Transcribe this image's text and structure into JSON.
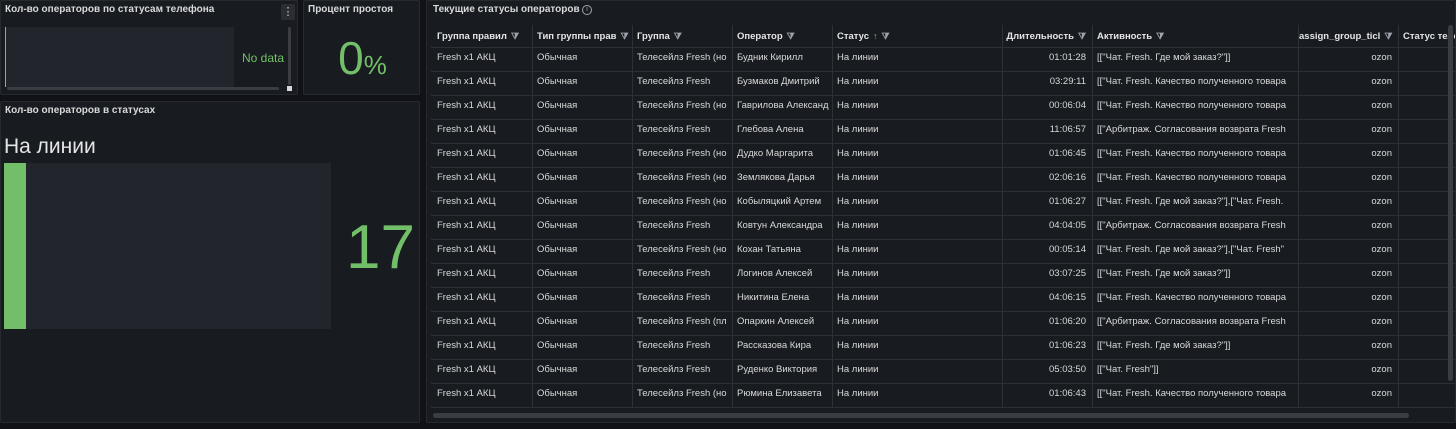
{
  "panels": {
    "phone_status": {
      "title": "Кол-во операторов по статусам телефона",
      "menu_icon": "kebab-icon",
      "no_data": "No data"
    },
    "idle_percent": {
      "title": "Процент простоя",
      "value": "0",
      "unit": "%"
    },
    "status_count": {
      "title": "Кол-во операторов в статусах",
      "status_label": "На линии",
      "value": "17",
      "color": "#73bf69"
    },
    "current_statuses": {
      "title": "Текущие статусы операторов",
      "info_icon": "info-circle-icon"
    }
  },
  "table": {
    "headers": [
      "Группа правил",
      "Тип группы прав",
      "Группа",
      "Оператор",
      "Статус",
      "Длительность",
      "Активность",
      "assign_group_ticl",
      "Статус теле"
    ],
    "sort_icon": "sort-ascending-icon",
    "filter_icon": "filter-icon",
    "rows": [
      [
        "Fresh x1 АКЦ",
        "Обычная",
        "Телесейлз Fresh (но",
        "Будник Кирилл",
        "На линии",
        "01:01:28",
        "[[\"Чат. Fresh. Где мой заказ?\"]]",
        "ozon"
      ],
      [
        "Fresh x1 АКЦ",
        "Обычная",
        "Телесейлз Fresh",
        "Бузмаков Дмитрий",
        "На линии",
        "03:29:11",
        "[[\"Чат. Fresh. Качество полученного товара",
        "ozon"
      ],
      [
        "Fresh x1 АКЦ",
        "Обычная",
        "Телесейлз Fresh (но",
        "Гаврилова Александ",
        "На линии",
        "00:06:04",
        "[[\"Чат. Fresh. Качество полученного товара",
        "ozon"
      ],
      [
        "Fresh x1 АКЦ",
        "Обычная",
        "Телесейлз Fresh",
        "Глебова Алена",
        "На линии",
        "11:06:57",
        "[[\"Арбитраж. Согласования возврата Fresh",
        "ozon"
      ],
      [
        "Fresh x1 АКЦ",
        "Обычная",
        "Телесейлз Fresh (но",
        "Дудко Маргарита",
        "На линии",
        "01:06:45",
        "[[\"Чат. Fresh. Качество полученного товара",
        "ozon"
      ],
      [
        "Fresh x1 АКЦ",
        "Обычная",
        "Телесейлз Fresh (но",
        "Землякова Дарья",
        "На линии",
        "02:06:16",
        "[[\"Чат. Fresh. Качество полученного товара",
        "ozon"
      ],
      [
        "Fresh x1 АКЦ",
        "Обычная",
        "Телесейлз Fresh (но",
        "Кобыляцкий Артем",
        "На линии",
        "01:06:27",
        "[[\"Чат. Fresh. Где мой заказ?\"],[\"Чат. Fresh.",
        "ozon"
      ],
      [
        "Fresh x1 АКЦ",
        "Обычная",
        "Телесейлз Fresh",
        "Ковтун Александра",
        "На линии",
        "04:04:05",
        "[[\"Арбитраж. Согласования возврата Fresh",
        "ozon"
      ],
      [
        "Fresh x1 АКЦ",
        "Обычная",
        "Телесейлз Fresh (но",
        "Кохан Татьяна",
        "На линии",
        "00:05:14",
        "[[\"Чат. Fresh. Где мой заказ?\"],[\"Чат. Fresh\"",
        "ozon"
      ],
      [
        "Fresh x1 АКЦ",
        "Обычная",
        "Телесейлз Fresh",
        "Логинов Алексей",
        "На линии",
        "03:07:25",
        "[[\"Чат. Fresh. Где мой заказ?\"]]",
        "ozon"
      ],
      [
        "Fresh x1 АКЦ",
        "Обычная",
        "Телесейлз Fresh",
        "Никитина Елена",
        "На линии",
        "04:06:15",
        "[[\"Чат. Fresh. Качество полученного товара",
        "ozon"
      ],
      [
        "Fresh x1 АКЦ",
        "Обычная",
        "Телесейлз Fresh (пл",
        "Опаркин Алексей",
        "На линии",
        "01:06:20",
        "[[\"Арбитраж. Согласования возврата Fresh",
        "ozon"
      ],
      [
        "Fresh x1 АКЦ",
        "Обычная",
        "Телесейлз Fresh",
        "Рассказова Кира",
        "На линии",
        "01:06:23",
        "[[\"Чат. Fresh. Где мой заказ?\"]]",
        "ozon"
      ],
      [
        "Fresh x1 АКЦ",
        "Обычная",
        "Телесейлз Fresh",
        "Руденко Виктория",
        "На линии",
        "05:03:50",
        "[[\"Чат. Fresh\"]]",
        "ozon"
      ],
      [
        "Fresh x1 АКЦ",
        "Обычная",
        "Телесейлз Fresh (но",
        "Рюмина Елизавета",
        "На линии",
        "01:06:43",
        "[[\"Чат. Fresh. Качество полученного товара",
        "ozon"
      ]
    ]
  }
}
